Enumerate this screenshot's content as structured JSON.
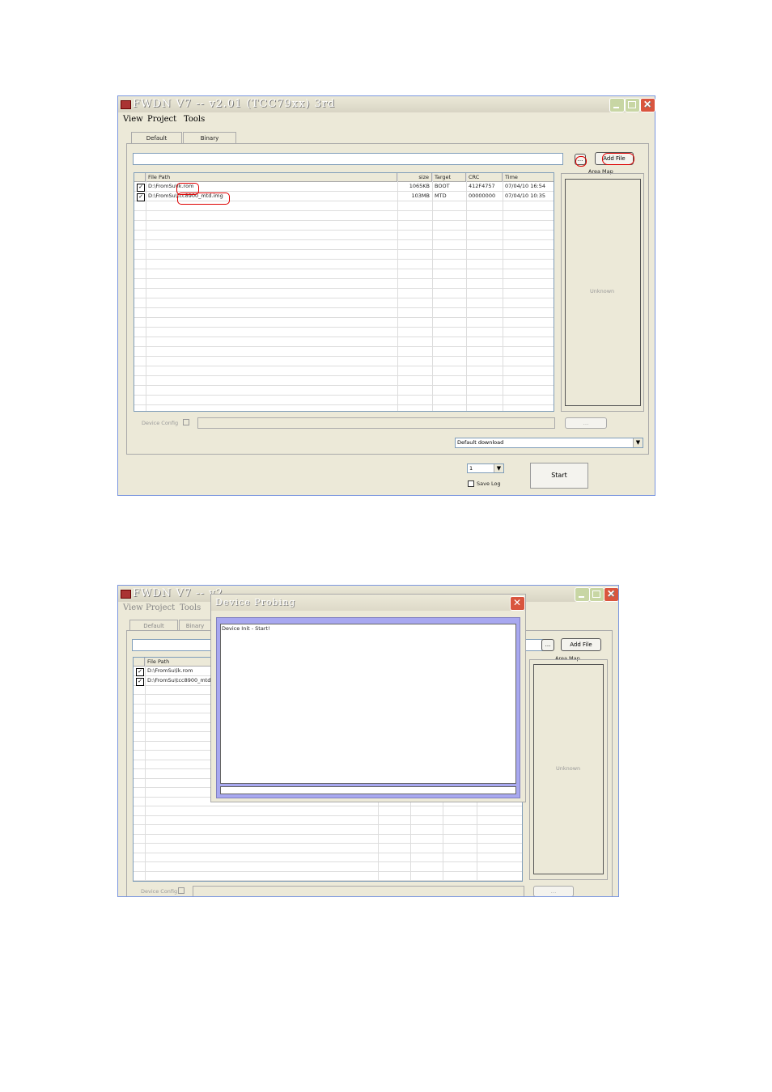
{
  "window": {
    "title": "FWDN V7 -- v2.01 (TCC79xx) 3rd",
    "menu": [
      "View",
      "Project",
      "Tools"
    ],
    "tabs": [
      "Default",
      "Binary"
    ],
    "add_file_label": "Add File",
    "browse_label": "...",
    "area_map_label": "Area Map",
    "area_map_state": "Unknown",
    "device_config_label": "Device Config",
    "device_config_button": "...",
    "download_mode": "Default download",
    "count_value": "1",
    "save_log_label": "Save Log",
    "start_label": "Start"
  },
  "file_list": {
    "columns": [
      "File Path",
      "size",
      "Target",
      "CRC",
      "Time"
    ],
    "rows": [
      {
        "checked": true,
        "path": "D:\\FromSu\\lk.rom",
        "size": "1065KB",
        "target": "BOOT",
        "crc": "412F4757",
        "time": "07/04/10 16:54"
      },
      {
        "checked": true,
        "path": "D:\\FromSu\\tcc8900_mtd.img",
        "size": "103MB",
        "target": "MTD",
        "crc": "00000000",
        "time": "07/04/10 10:35"
      }
    ]
  },
  "second_screen": {
    "title": "FWDN V7 -- v2",
    "menu": [
      "View",
      "Project",
      "Tools"
    ],
    "tabs": [
      "Default",
      "Binary"
    ],
    "rows": [
      "D:\\FromSu\\lk.rom",
      "D:\\FromSu\\tcc8900_mtd.i"
    ],
    "column_header": "File Path",
    "add_file_label": "Add File",
    "browse_label": "...",
    "area_map_label": "Area Map",
    "area_map_state": "Unknown",
    "device_config_label": "Device Config",
    "device_config_button": "..."
  },
  "probe_dialog": {
    "title": "Device Probing",
    "log_text": "Device Init - Start!"
  }
}
